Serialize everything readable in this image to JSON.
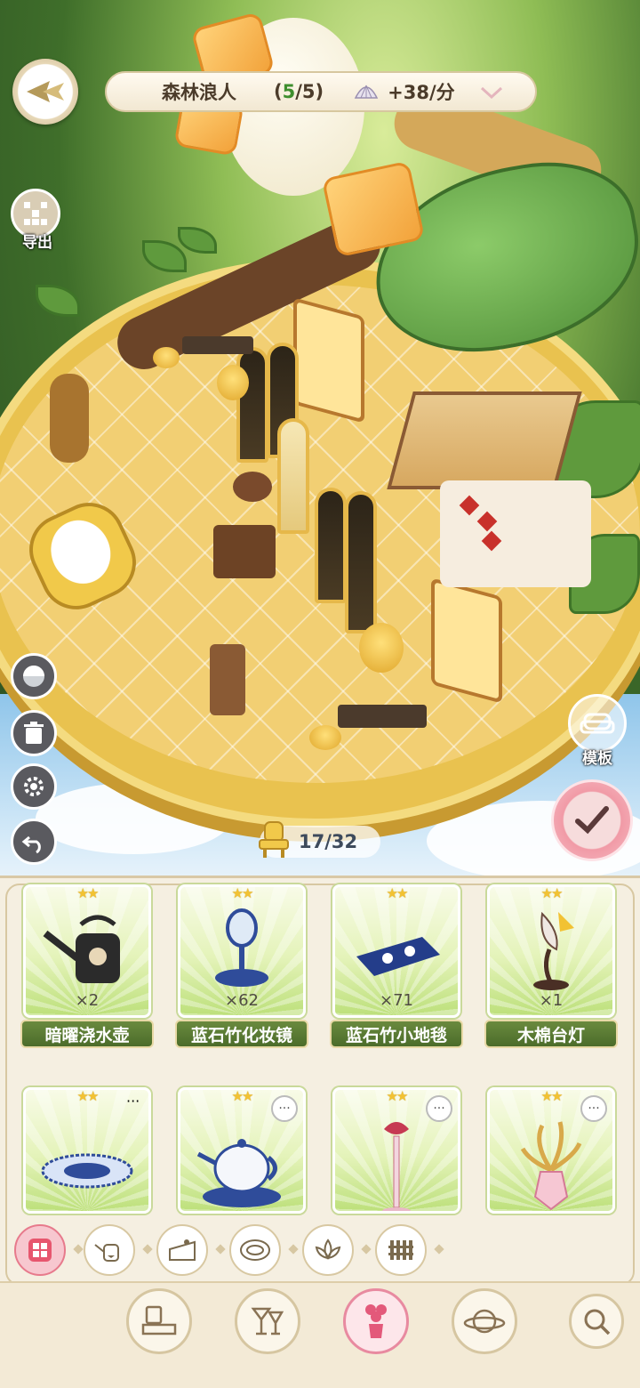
{
  "header": {
    "island_name": "森林浪人",
    "progress_open": "(",
    "progress_done": "5",
    "progress_rest": "/5)",
    "income_rate": "+38/分"
  },
  "left_tools": {
    "export_label": "导出"
  },
  "right_tools": {
    "template_label": "模板"
  },
  "capacity": {
    "text": "17/32",
    "used": 17,
    "max": 32
  },
  "items_row1": [
    {
      "stars": "★★",
      "count": "×2",
      "name": "暗曜浇水壶"
    },
    {
      "stars": "★★",
      "count": "×62",
      "name": "蓝石竹化妆镜"
    },
    {
      "stars": "★★",
      "count": "×71",
      "name": "蓝石竹小地毯"
    },
    {
      "stars": "★★",
      "count": "×1",
      "name": "木棉台灯"
    }
  ],
  "items_row2": [
    {
      "stars": "★★",
      "more": "···"
    },
    {
      "stars": "★★",
      "more": "···"
    },
    {
      "stars": "★★",
      "more": "···"
    },
    {
      "stars": "★★",
      "more": "···"
    }
  ],
  "categories": [
    "all-grid-icon",
    "watering-can-icon",
    "cake-icon",
    "plate-icon",
    "lotus-icon",
    "fence-icon"
  ],
  "nav": [
    "furniture-icon",
    "cocktail-icon",
    "flower-vase-icon",
    "planet-icon",
    "search-icon"
  ],
  "colors": {
    "accent_pink": "#f19aa6",
    "card_green": "#bde07b",
    "name_plate": "#4b6c2a"
  }
}
